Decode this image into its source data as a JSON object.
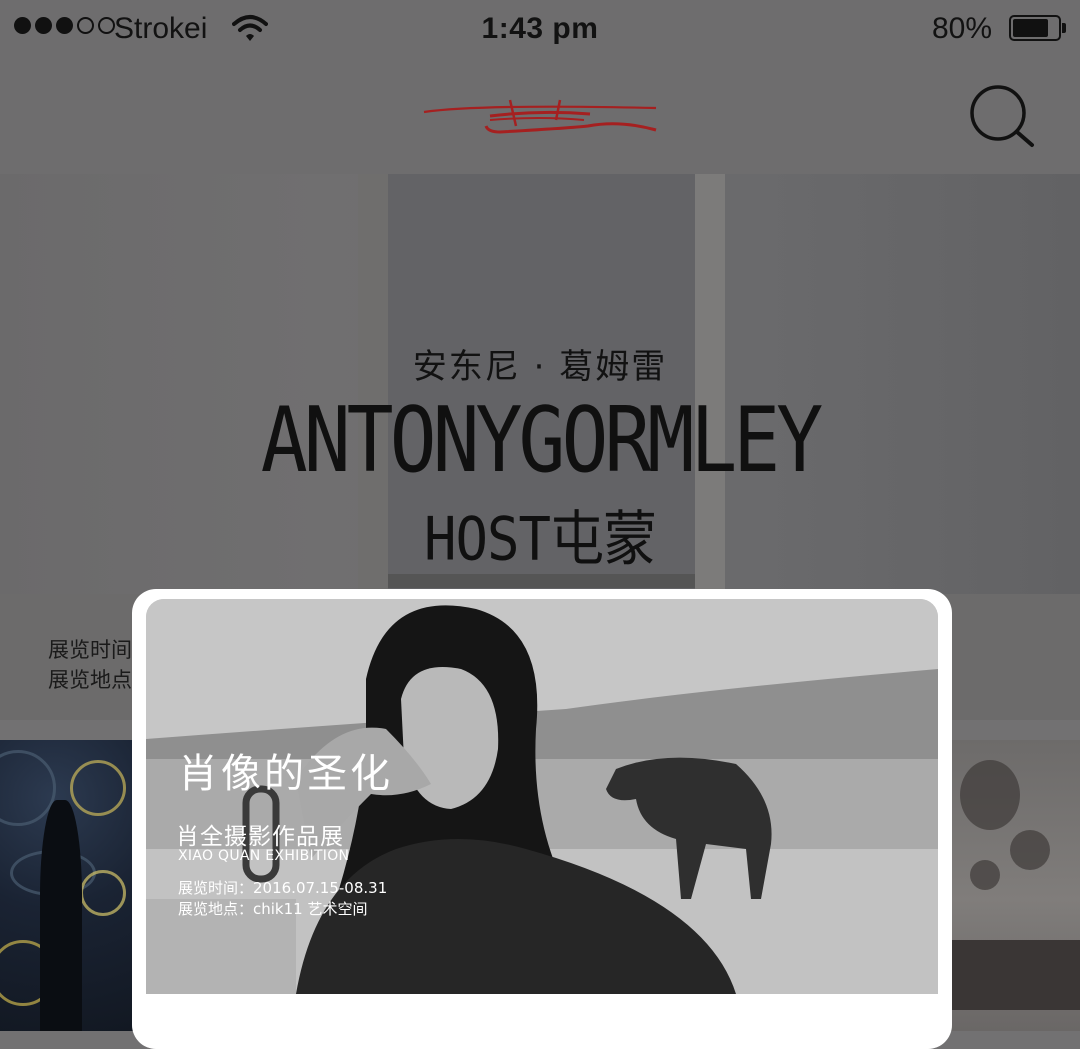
{
  "status_bar": {
    "carrier": "Strokei",
    "time": "1:43 pm",
    "battery_percent": "80%",
    "battery_level": 0.8,
    "signal_bars_filled": 3,
    "signal_bars_total": 5
  },
  "nav": {
    "logo_icon": "brush-stroke-logo",
    "search_icon": "search-icon",
    "logo_color": "#a52020"
  },
  "hero": {
    "subtitle": "安东尼 · 葛姆雷",
    "title": "ANTONYGORMLEY",
    "title2": "HOST屯蒙",
    "time_label": "展览时间",
    "place_label": "展览地点"
  },
  "featured": {
    "title": "肖像的圣化",
    "subtitle_cn": "肖全摄影作品展",
    "subtitle_en": "XIAO QUAN EXHIBITION",
    "time_line": "展览时间：2016.07.15-08.31",
    "place_line": "展览地点：chik11 艺术空间"
  }
}
